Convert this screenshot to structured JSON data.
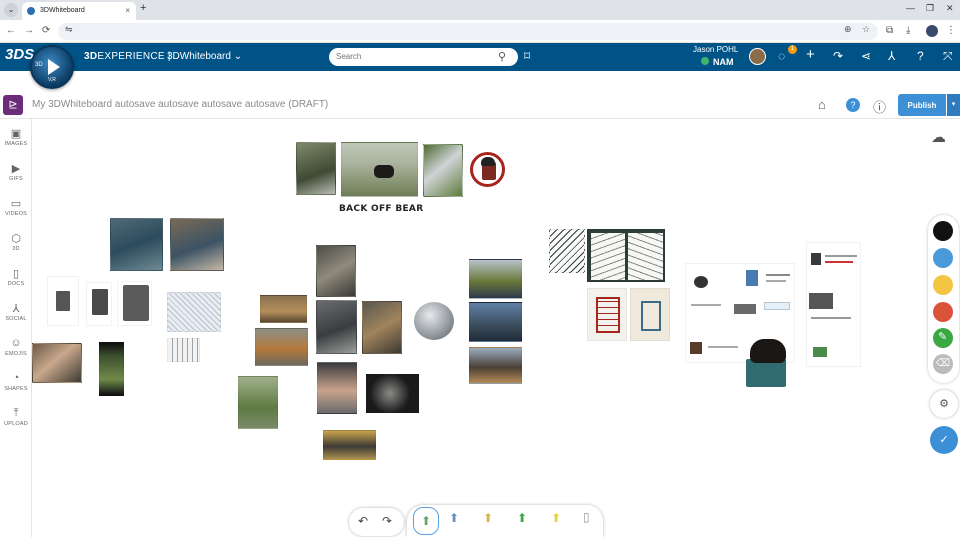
{
  "browser": {
    "tab_title": "3DWhiteboard",
    "tab_close": "×",
    "new_tab": "+",
    "menu": "⌄",
    "win_min": "—",
    "win_max": "❐",
    "win_close": "✕",
    "back": "←",
    "forward": "→",
    "reload": "⟳",
    "site_info": "⇋",
    "zoom_icon": "⊕",
    "star_icon": "☆",
    "ext_icon": "⧉",
    "download_icon": "⤓",
    "more_icon": "⋮"
  },
  "topbar": {
    "logo": "3DS",
    "compass_3d": "3D",
    "compass_vr": "V,R",
    "brand_bold": "3D",
    "brand_rest": "EXPERIENCE |",
    "app_name": "3DWhiteboard ⌄",
    "search_placeholder": "Search",
    "search_icon": "⚲",
    "tag_icon": "⌑",
    "user_name": "Jason POHL",
    "tenant": "NAM",
    "notif_count": "1",
    "icons": {
      "chat": "◌",
      "add": "+",
      "share": "↷",
      "network": "⋖",
      "apps": "⅄",
      "help": "?",
      "fullscreen": "⤧"
    }
  },
  "header": {
    "app_icon": "⊵",
    "title": "My 3DWhiteboard autosave autosave autosave autosave (DRAFT)",
    "home_icon": "⌂",
    "help_icon": "?",
    "info_icon": "ⓘ",
    "publish": "Publish",
    "publish_caret": "▾"
  },
  "rail": [
    {
      "label": "IMAGES",
      "icon": "▣"
    },
    {
      "label": "GIFS",
      "icon": "▶"
    },
    {
      "label": "VIDEOS",
      "icon": "▭"
    },
    {
      "label": "3D",
      "icon": "⬡"
    },
    {
      "label": "DOCS",
      "icon": "▯"
    },
    {
      "label": "SOCIAL",
      "icon": "⅄"
    },
    {
      "label": "EMOJIS",
      "icon": "☺"
    },
    {
      "label": "SHAPES",
      "icon": "◔"
    },
    {
      "label": "UPLOAD",
      "icon": "⤒"
    }
  ],
  "canvas": {
    "caption": "BACK OFF BEAR"
  },
  "right_tools": {
    "cloud_icon": "☁",
    "colors": [
      "#111111",
      "#4a9ad9",
      "#f4c542",
      "#d9533b",
      "#3aa843"
    ],
    "eraser_icon": "⌫",
    "settings_icon": "⚙",
    "confirm_icon": "✓"
  },
  "bottom": {
    "undo": "↶",
    "redo": "↷",
    "pens": [
      "⬆",
      "⬆",
      "⬆",
      "⬆",
      "⬆",
      "▯"
    ]
  }
}
